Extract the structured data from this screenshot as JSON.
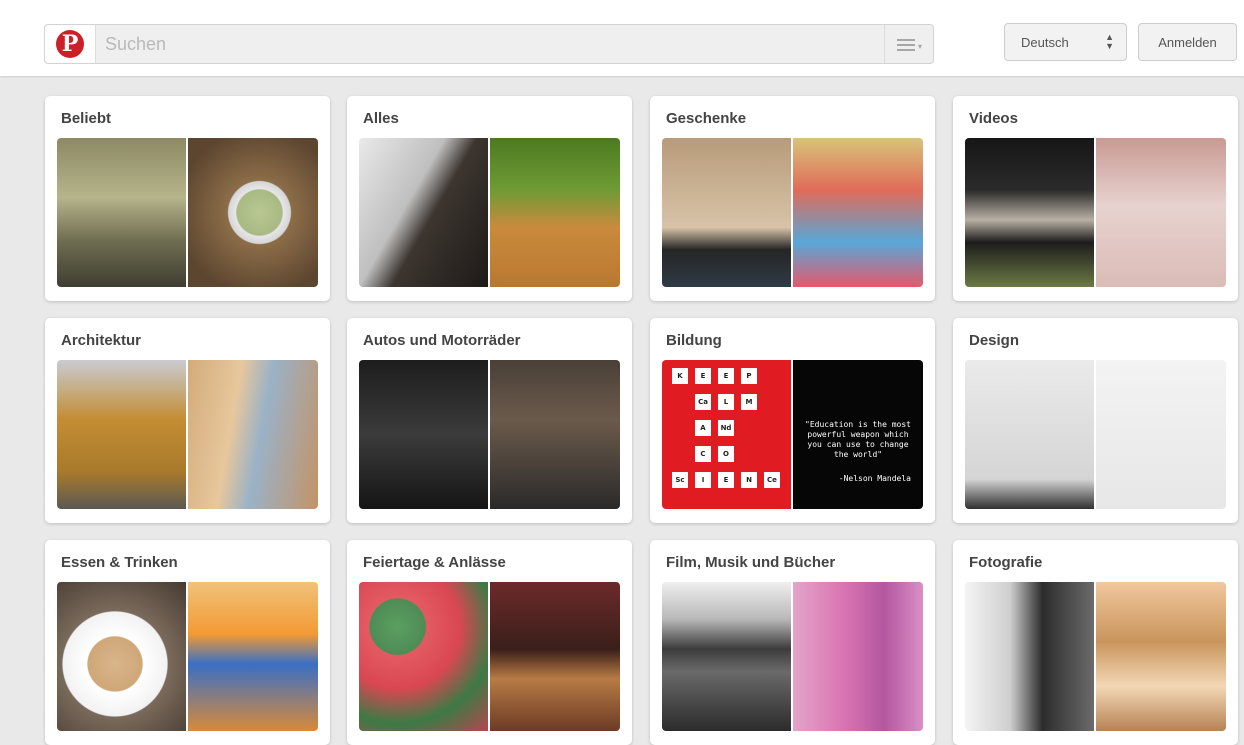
{
  "header": {
    "logo_letter": "P",
    "search_placeholder": "Suchen",
    "language": "Deutsch",
    "login": "Anmelden"
  },
  "categories": [
    {
      "title": "Beliebt"
    },
    {
      "title": "Alles"
    },
    {
      "title": "Geschenke"
    },
    {
      "title": "Videos"
    },
    {
      "title": "Architektur"
    },
    {
      "title": "Autos und Motorräder"
    },
    {
      "title": "Bildung"
    },
    {
      "title": "Design"
    },
    {
      "title": "Essen & Trinken"
    },
    {
      "title": "Feiertage & Anlässe"
    },
    {
      "title": "Film, Musik und Bücher"
    },
    {
      "title": "Fotografie"
    }
  ],
  "bildung_image": {
    "quote": "\"Education is the most powerful weapon which you can use to change the world\"",
    "author": "-Nelson Mandela",
    "tiles": [
      "K",
      "E",
      "E",
      "P",
      "Ca",
      "L",
      "M",
      "A",
      "Nd",
      "C",
      "O",
      "Sc",
      "I",
      "E",
      "N",
      "Ce"
    ]
  }
}
